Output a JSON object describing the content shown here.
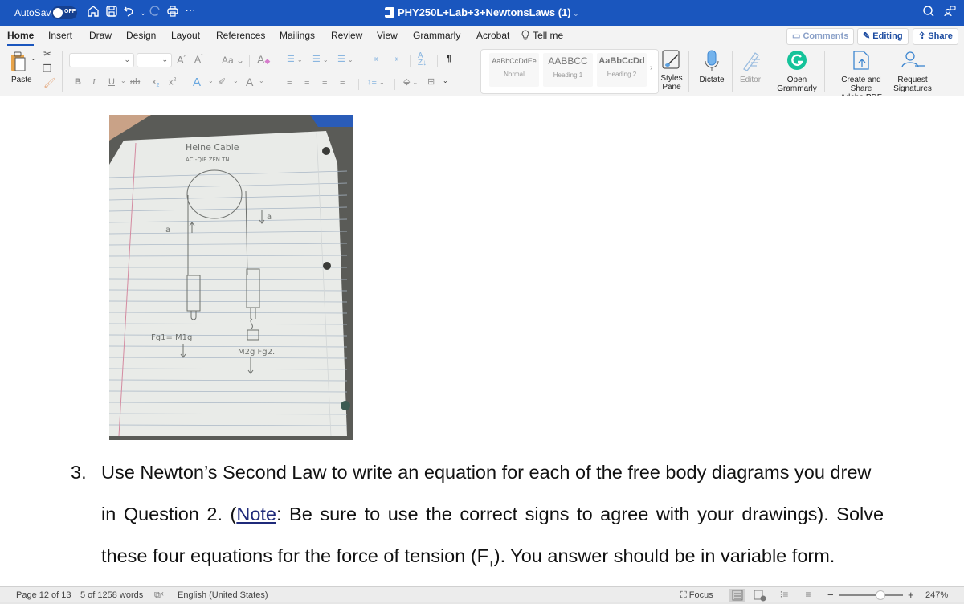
{
  "titlebar": {
    "autosave_label": "AutoSave",
    "autosave_state": "OFF",
    "document_title": "PHY250L+Lab+3+NewtonsLaws (1)",
    "quick_access": [
      "home-icon",
      "save-icon",
      "undo-icon",
      "redo-icon",
      "print-icon",
      "more-icon"
    ]
  },
  "tabs": [
    "Home",
    "Insert",
    "Draw",
    "Design",
    "Layout",
    "References",
    "Mailings",
    "Review",
    "View",
    "Grammarly",
    "Acrobat"
  ],
  "active_tab": "Home",
  "tell_me": "Tell me",
  "actions": {
    "comments": "Comments",
    "editing": "Editing",
    "share": "Share"
  },
  "ribbon": {
    "paste": "Paste",
    "font_name": "",
    "font_size": "",
    "styles": [
      {
        "sample": "AaBbCcDdEe",
        "name": "Normal"
      },
      {
        "sample": "AABBCC",
        "name": "Heading 1"
      },
      {
        "sample": "AaBbCcDd",
        "name": "Heading 2"
      }
    ],
    "styles_pane": [
      "Styles",
      "Pane"
    ],
    "dictate": "Dictate",
    "editor": "Editor",
    "open_grammarly": [
      "Open",
      "Grammarly"
    ],
    "create_share_pdf": [
      "Create and Share",
      "Adobe PDF"
    ],
    "request_signatures": [
      "Request",
      "Signatures"
    ]
  },
  "photo": {
    "heading_line1": "Heine Cable",
    "heading_line2": "AC -QIE ZFN TN.",
    "label_a_left": "a",
    "label_a_right": "a",
    "label_fg1": "Fg1= M1g",
    "label_fg2": "M2g  Fg2."
  },
  "document": {
    "item_number": "3.",
    "line1": "Use Newton’s Second Law to write an equation for each of the free body diagrams you drew",
    "line2_pre": "in Question 2. (",
    "line2_link": "Note",
    "line2_post": ": Be sure to use the correct signs to agree with your drawings). Solve",
    "line3_pre": "these four equations for the force of tension (F",
    "line3_sub": "T",
    "line3_post": "). You answer should be in variable form."
  },
  "statusbar": {
    "page": "Page 12 of 13",
    "words": "5 of 1258 words",
    "language": "English (United States)",
    "focus": "Focus",
    "zoom": "247%",
    "zoom_minus": "−",
    "zoom_plus": "+"
  }
}
